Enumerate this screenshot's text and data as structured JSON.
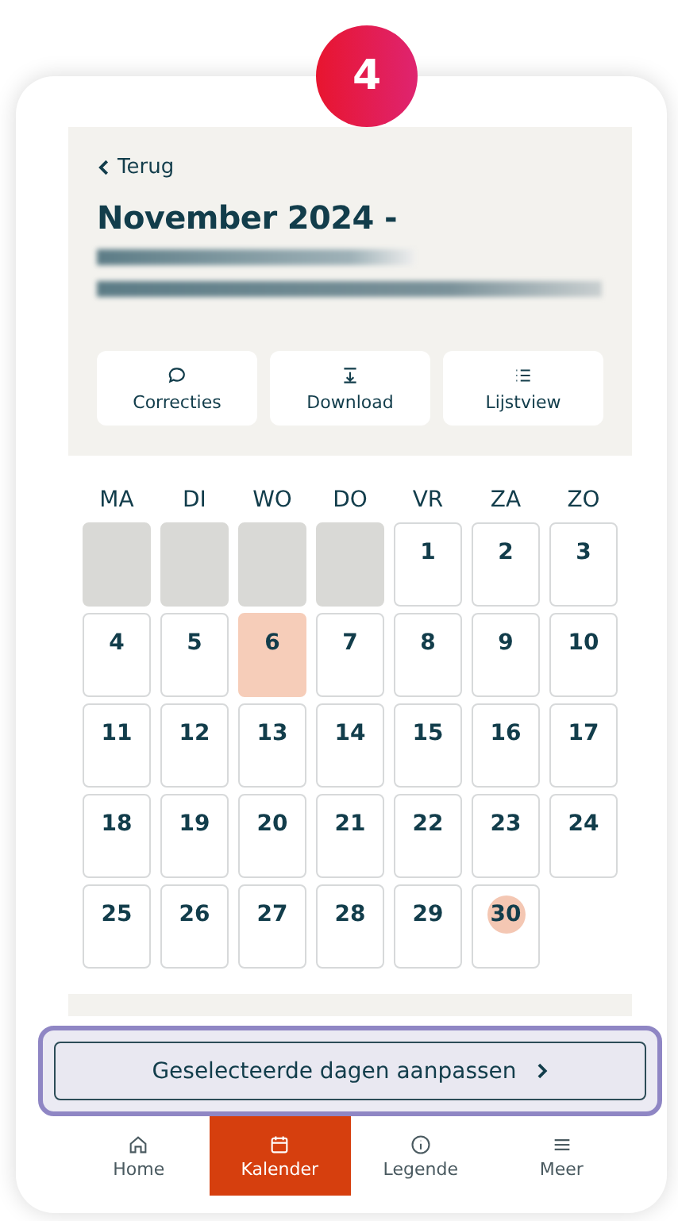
{
  "step_badge": "4",
  "header": {
    "back": "Terug",
    "title": "November 2024 -",
    "actions": [
      {
        "label": "Correcties",
        "kind": "chat"
      },
      {
        "label": "Download",
        "kind": "pdf"
      },
      {
        "label": "Lijstview",
        "kind": "list"
      }
    ]
  },
  "calendar": {
    "weekdays": [
      "MA",
      "DI",
      "WO",
      "DO",
      "VR",
      "ZA",
      "ZO"
    ],
    "days": [
      {
        "kind": "blank"
      },
      {
        "kind": "blank"
      },
      {
        "kind": "blank"
      },
      {
        "kind": "blank"
      },
      {
        "kind": "day",
        "label": "1",
        "selected": false,
        "today": false
      },
      {
        "kind": "day",
        "label": "2",
        "selected": false,
        "today": false
      },
      {
        "kind": "day",
        "label": "3",
        "selected": false,
        "today": false
      },
      {
        "kind": "day",
        "label": "4",
        "selected": false,
        "today": false
      },
      {
        "kind": "day",
        "label": "5",
        "selected": false,
        "today": false
      },
      {
        "kind": "day",
        "label": "6",
        "selected": true,
        "today": false
      },
      {
        "kind": "day",
        "label": "7",
        "selected": false,
        "today": false
      },
      {
        "kind": "day",
        "label": "8",
        "selected": false,
        "today": false
      },
      {
        "kind": "day",
        "label": "9",
        "selected": false,
        "today": false
      },
      {
        "kind": "day",
        "label": "10",
        "selected": false,
        "today": false
      },
      {
        "kind": "day",
        "label": "11",
        "selected": false,
        "today": false
      },
      {
        "kind": "day",
        "label": "12",
        "selected": false,
        "today": false
      },
      {
        "kind": "day",
        "label": "13",
        "selected": false,
        "today": false
      },
      {
        "kind": "day",
        "label": "14",
        "selected": false,
        "today": false
      },
      {
        "kind": "day",
        "label": "15",
        "selected": false,
        "today": false
      },
      {
        "kind": "day",
        "label": "16",
        "selected": false,
        "today": false
      },
      {
        "kind": "day",
        "label": "17",
        "selected": false,
        "today": false
      },
      {
        "kind": "day",
        "label": "18",
        "selected": false,
        "today": false
      },
      {
        "kind": "day",
        "label": "19",
        "selected": false,
        "today": false
      },
      {
        "kind": "day",
        "label": "20",
        "selected": false,
        "today": false
      },
      {
        "kind": "day",
        "label": "21",
        "selected": false,
        "today": false
      },
      {
        "kind": "day",
        "label": "22",
        "selected": false,
        "today": false
      },
      {
        "kind": "day",
        "label": "23",
        "selected": false,
        "today": false
      },
      {
        "kind": "day",
        "label": "24",
        "selected": false,
        "today": false
      },
      {
        "kind": "day",
        "label": "25",
        "selected": false,
        "today": false
      },
      {
        "kind": "day",
        "label": "26",
        "selected": false,
        "today": false
      },
      {
        "kind": "day",
        "label": "27",
        "selected": false,
        "today": false
      },
      {
        "kind": "day",
        "label": "28",
        "selected": false,
        "today": false
      },
      {
        "kind": "day",
        "label": "29",
        "selected": false,
        "today": false
      },
      {
        "kind": "day",
        "label": "30",
        "selected": false,
        "today": true
      }
    ]
  },
  "action_button": {
    "label": "Geselecteerde dagen aanpassen",
    "highlighted": true
  },
  "nav": [
    {
      "label": "Home",
      "kind": "home",
      "selected": false
    },
    {
      "label": "Kalender",
      "kind": "calendar",
      "selected": true
    },
    {
      "label": "Legende",
      "kind": "info",
      "selected": false
    },
    {
      "label": "Meer",
      "kind": "menu",
      "selected": false
    }
  ]
}
